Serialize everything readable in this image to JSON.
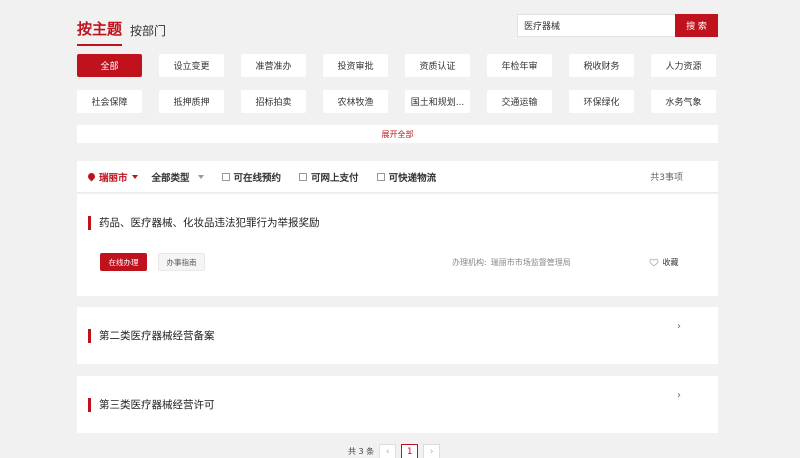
{
  "tabs": {
    "active": "按主题",
    "other": "按部门"
  },
  "search": {
    "value": "医疗器械",
    "button": "搜 索"
  },
  "categories": [
    {
      "label": "全部",
      "active": true
    },
    {
      "label": "设立变更"
    },
    {
      "label": "准营准办"
    },
    {
      "label": "投资审批"
    },
    {
      "label": "资质认证"
    },
    {
      "label": "年检年审"
    },
    {
      "label": "税收财务"
    },
    {
      "label": "人力资源"
    },
    {
      "label": "社会保障"
    },
    {
      "label": "抵押质押"
    },
    {
      "label": "招标拍卖"
    },
    {
      "label": "农林牧渔"
    },
    {
      "label": "国土和规划..."
    },
    {
      "label": "交通运输"
    },
    {
      "label": "环保绿化"
    },
    {
      "label": "水务气象"
    }
  ],
  "expand_label": "展开全部",
  "filter": {
    "city": "瑞丽市",
    "type": "全部类型",
    "checks": [
      "可在线预约",
      "可网上支付",
      "可快递物流"
    ],
    "total": "共3事项"
  },
  "items": [
    {
      "title": "药品、医疗器械、化妆品违法犯罪行为举报奖励",
      "online_label": "在线办理",
      "guide_label": "办事指南",
      "agency_label": "办理机构:",
      "agency": "瑞丽市市场监督管理局",
      "fav_label": "收藏"
    },
    {
      "title": "第二类医疗器械经营备案"
    },
    {
      "title": "第三类医疗器械经营许可"
    }
  ],
  "pager": {
    "total": "共 3 条",
    "prev": "‹",
    "current": "1",
    "next": "›"
  },
  "colors": {
    "accent": "#c0121d",
    "background": "#f1f1f1"
  }
}
